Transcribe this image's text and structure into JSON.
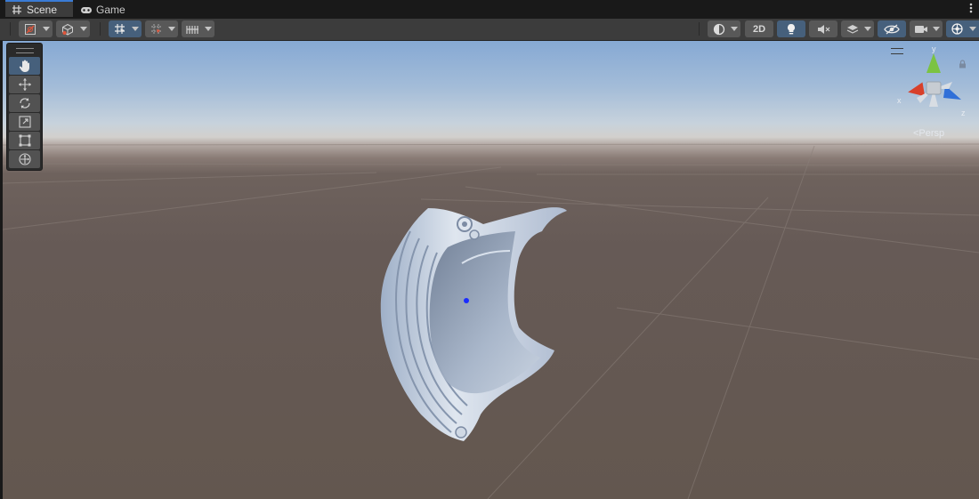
{
  "tabs": [
    {
      "label": "Scene",
      "icon": "grid-icon",
      "active": true
    },
    {
      "label": "Game",
      "icon": "gamepad-icon",
      "active": false
    }
  ],
  "toolbar": {
    "two_d_label": "2D"
  },
  "tools": [
    "hand-tool",
    "move-tool",
    "rotate-tool",
    "scale-tool",
    "rect-tool",
    "transform-tool"
  ],
  "gizmo": {
    "y_label": "y",
    "x_label": "x",
    "z_label": "z",
    "projection": "<Persp"
  },
  "colors": {
    "x_axis": "#d8402a",
    "y_axis": "#7bc342",
    "z_axis": "#2f6fd8",
    "active_tool": "#46607c",
    "tab_highlight": "#3a7bd5"
  }
}
